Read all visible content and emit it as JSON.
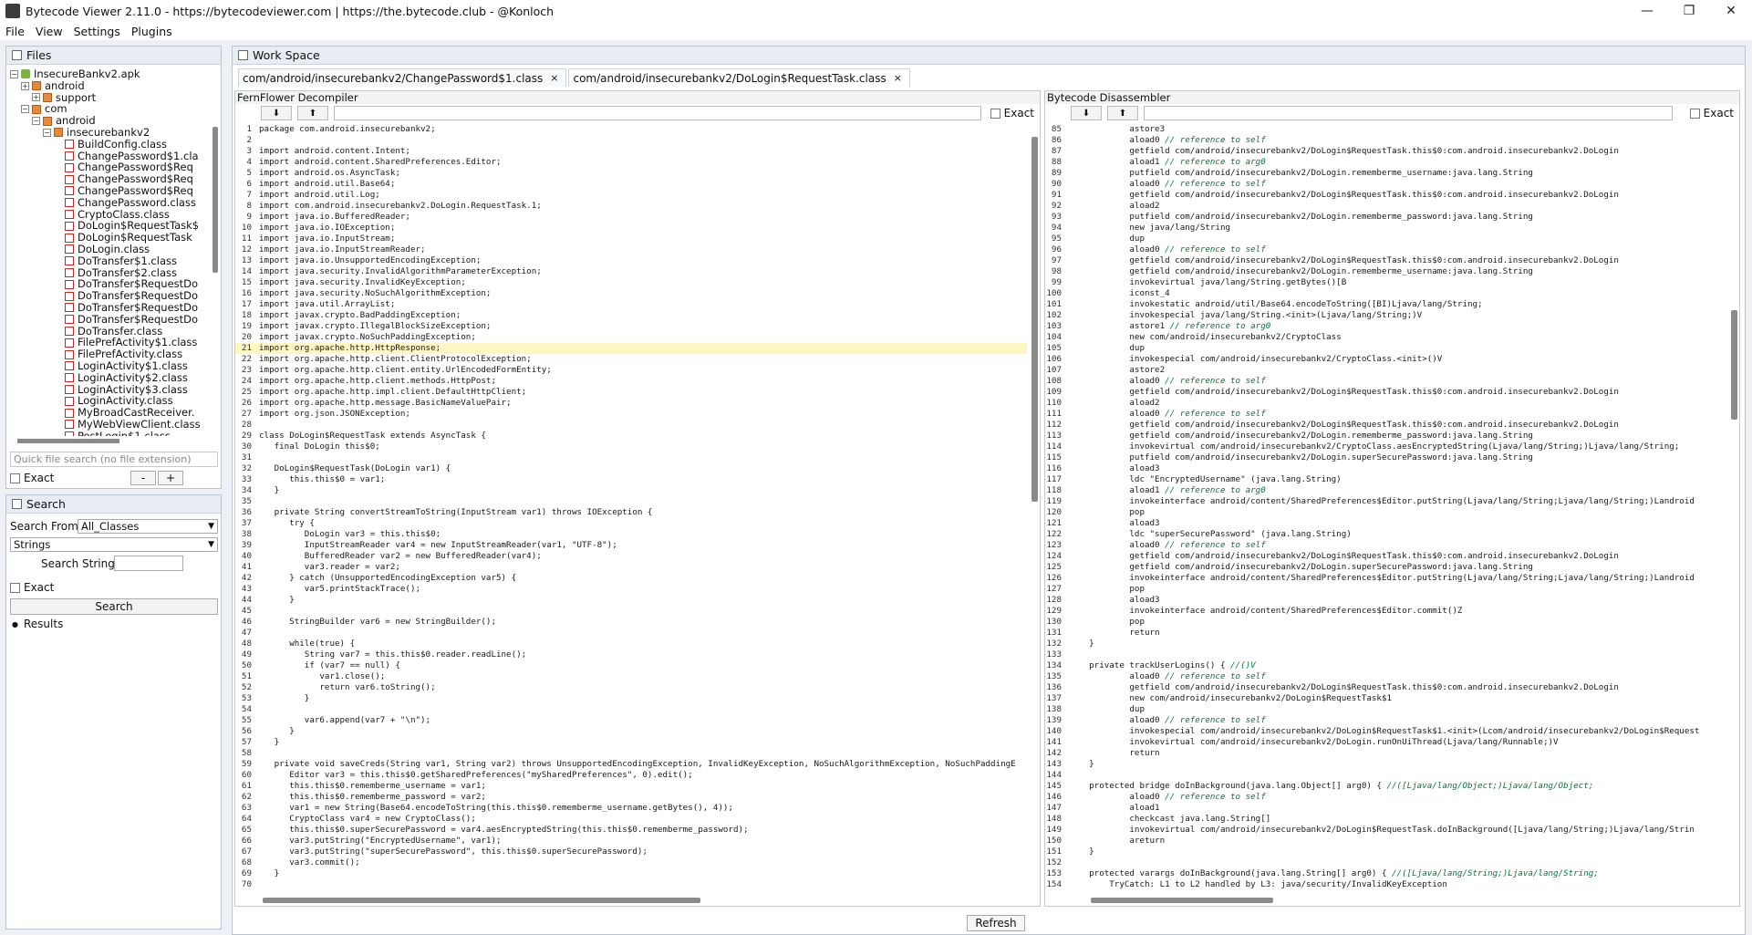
{
  "window": {
    "title": "Bytecode Viewer 2.11.0 - https://bytecodeviewer.com | https://the.bytecode.club - @Konloch"
  },
  "menu": [
    "File",
    "View",
    "Settings",
    "Plugins"
  ],
  "files": {
    "header": "Files",
    "tree": [
      {
        "label": "InsecureBankv2.apk",
        "depth": 0,
        "icon": "apk-icon",
        "exp": "−"
      },
      {
        "label": "android",
        "depth": 1,
        "icon": "package-icon",
        "exp": "+"
      },
      {
        "label": "support",
        "depth": 2,
        "icon": "package-icon",
        "exp": "+"
      },
      {
        "label": "com",
        "depth": 1,
        "icon": "package-icon",
        "exp": "−"
      },
      {
        "label": "android",
        "depth": 2,
        "icon": "package-icon",
        "exp": "−"
      },
      {
        "label": "insecurebankv2",
        "depth": 3,
        "icon": "package-icon",
        "exp": "−"
      },
      {
        "label": "BuildConfig.class",
        "depth": 4,
        "icon": "class-icon"
      },
      {
        "label": "ChangePassword$1.cla",
        "depth": 4,
        "icon": "class-icon"
      },
      {
        "label": "ChangePassword$Req",
        "depth": 4,
        "icon": "class-icon"
      },
      {
        "label": "ChangePassword$Req",
        "depth": 4,
        "icon": "class-icon"
      },
      {
        "label": "ChangePassword$Req",
        "depth": 4,
        "icon": "class-icon"
      },
      {
        "label": "ChangePassword.class",
        "depth": 4,
        "icon": "class-icon"
      },
      {
        "label": "CryptoClass.class",
        "depth": 4,
        "icon": "class-icon"
      },
      {
        "label": "DoLogin$RequestTask$",
        "depth": 4,
        "icon": "class-icon"
      },
      {
        "label": "DoLogin$RequestTask",
        "depth": 4,
        "icon": "class-icon"
      },
      {
        "label": "DoLogin.class",
        "depth": 4,
        "icon": "class-icon"
      },
      {
        "label": "DoTransfer$1.class",
        "depth": 4,
        "icon": "class-icon"
      },
      {
        "label": "DoTransfer$2.class",
        "depth": 4,
        "icon": "class-icon"
      },
      {
        "label": "DoTransfer$RequestDo",
        "depth": 4,
        "icon": "class-icon"
      },
      {
        "label": "DoTransfer$RequestDo",
        "depth": 4,
        "icon": "class-icon"
      },
      {
        "label": "DoTransfer$RequestDo",
        "depth": 4,
        "icon": "class-icon"
      },
      {
        "label": "DoTransfer$RequestDo",
        "depth": 4,
        "icon": "class-icon"
      },
      {
        "label": "DoTransfer.class",
        "depth": 4,
        "icon": "class-icon"
      },
      {
        "label": "FilePrefActivity$1.class",
        "depth": 4,
        "icon": "class-icon"
      },
      {
        "label": "FilePrefActivity.class",
        "depth": 4,
        "icon": "class-icon"
      },
      {
        "label": "LoginActivity$1.class",
        "depth": 4,
        "icon": "class-icon"
      },
      {
        "label": "LoginActivity$2.class",
        "depth": 4,
        "icon": "class-icon"
      },
      {
        "label": "LoginActivity$3.class",
        "depth": 4,
        "icon": "class-icon"
      },
      {
        "label": "LoginActivity.class",
        "depth": 4,
        "icon": "class-icon"
      },
      {
        "label": "MyBroadCastReceiver.",
        "depth": 4,
        "icon": "class-icon"
      },
      {
        "label": "MyWebViewClient.class",
        "depth": 4,
        "icon": "class-icon"
      },
      {
        "label": "PostLogin$1.class",
        "depth": 4,
        "icon": "class-icon"
      }
    ],
    "quick_search_placeholder": "Quick file search (no file extension)",
    "exact_label": "Exact",
    "minus_label": "-",
    "plus_label": "+"
  },
  "search": {
    "header": "Search",
    "from_label": "Search From:",
    "from_value": "All_Classes",
    "type_value": "Strings",
    "string_label": "Search String:",
    "exact_label": "Exact",
    "button": "Search",
    "results_label": "Results"
  },
  "workspace": {
    "header": "Work Space",
    "tabs": [
      {
        "label": "com/android/insecurebankv2/ChangePassword$1.class",
        "close": "×"
      },
      {
        "label": "com/android/insecurebankv2/DoLogin$RequestTask.class",
        "close": "×"
      }
    ],
    "refresh": "Refresh"
  },
  "decompiler": {
    "title": "FernFlower Decompiler",
    "exact_label": "Exact",
    "highlight_line": 21,
    "lines": [
      {
        "n": "1",
        "t": "package com.android.insecurebankv2;"
      },
      {
        "n": "2",
        "t": ""
      },
      {
        "n": "3",
        "t": "import android.content.Intent;"
      },
      {
        "n": "4",
        "t": "import android.content.SharedPreferences.Editor;"
      },
      {
        "n": "5",
        "t": "import android.os.AsyncTask;"
      },
      {
        "n": "6",
        "t": "import android.util.Base64;"
      },
      {
        "n": "7",
        "t": "import android.util.Log;"
      },
      {
        "n": "8",
        "t": "import com.android.insecurebankv2.DoLogin.RequestTask.1;"
      },
      {
        "n": "9",
        "t": "import java.io.BufferedReader;"
      },
      {
        "n": "10",
        "t": "import java.io.IOException;"
      },
      {
        "n": "11",
        "t": "import java.io.InputStream;"
      },
      {
        "n": "12",
        "t": "import java.io.InputStreamReader;"
      },
      {
        "n": "13",
        "t": "import java.io.UnsupportedEncodingException;"
      },
      {
        "n": "14",
        "t": "import java.security.InvalidAlgorithmParameterException;"
      },
      {
        "n": "15",
        "t": "import java.security.InvalidKeyException;"
      },
      {
        "n": "16",
        "t": "import java.security.NoSuchAlgorithmException;"
      },
      {
        "n": "17",
        "t": "import java.util.ArrayList;"
      },
      {
        "n": "18",
        "t": "import javax.crypto.BadPaddingException;"
      },
      {
        "n": "19",
        "t": "import javax.crypto.IllegalBlockSizeException;"
      },
      {
        "n": "20",
        "t": "import javax.crypto.NoSuchPaddingException;"
      },
      {
        "n": "21",
        "t": "import org.apache.http.HttpResponse;"
      },
      {
        "n": "22",
        "t": "import org.apache.http.client.ClientProtocolException;"
      },
      {
        "n": "23",
        "t": "import org.apache.http.client.entity.UrlEncodedFormEntity;"
      },
      {
        "n": "24",
        "t": "import org.apache.http.client.methods.HttpPost;"
      },
      {
        "n": "25",
        "t": "import org.apache.http.impl.client.DefaultHttpClient;"
      },
      {
        "n": "26",
        "t": "import org.apache.http.message.BasicNameValuePair;"
      },
      {
        "n": "27",
        "t": "import org.json.JSONException;"
      },
      {
        "n": "28",
        "t": ""
      },
      {
        "n": "29",
        "t": "class DoLogin$RequestTask extends AsyncTask {"
      },
      {
        "n": "30",
        "t": "   final DoLogin this$0;"
      },
      {
        "n": "31",
        "t": ""
      },
      {
        "n": "32",
        "t": "   DoLogin$RequestTask(DoLogin var1) {"
      },
      {
        "n": "33",
        "t": "      this.this$0 = var1;"
      },
      {
        "n": "34",
        "t": "   }"
      },
      {
        "n": "35",
        "t": ""
      },
      {
        "n": "36",
        "t": "   private String convertStreamToString(InputStream var1) throws IOException {"
      },
      {
        "n": "37",
        "t": "      try {"
      },
      {
        "n": "38",
        "t": "         DoLogin var3 = this.this$0;"
      },
      {
        "n": "39",
        "t": "         InputStreamReader var4 = new InputStreamReader(var1, \"UTF-8\");"
      },
      {
        "n": "40",
        "t": "         BufferedReader var2 = new BufferedReader(var4);"
      },
      {
        "n": "41",
        "t": "         var3.reader = var2;"
      },
      {
        "n": "42",
        "t": "      } catch (UnsupportedEncodingException var5) {"
      },
      {
        "n": "43",
        "t": "         var5.printStackTrace();"
      },
      {
        "n": "44",
        "t": "      }"
      },
      {
        "n": "45",
        "t": ""
      },
      {
        "n": "46",
        "t": "      StringBuilder var6 = new StringBuilder();"
      },
      {
        "n": "47",
        "t": ""
      },
      {
        "n": "48",
        "t": "      while(true) {"
      },
      {
        "n": "49",
        "t": "         String var7 = this.this$0.reader.readLine();"
      },
      {
        "n": "50",
        "t": "         if (var7 == null) {"
      },
      {
        "n": "51",
        "t": "            var1.close();"
      },
      {
        "n": "52",
        "t": "            return var6.toString();"
      },
      {
        "n": "53",
        "t": "         }"
      },
      {
        "n": "54",
        "t": ""
      },
      {
        "n": "55",
        "t": "         var6.append(var7 + \"\\n\");"
      },
      {
        "n": "56",
        "t": "      }"
      },
      {
        "n": "57",
        "t": "   }"
      },
      {
        "n": "58",
        "t": ""
      },
      {
        "n": "59",
        "t": "   private void saveCreds(String var1, String var2) throws UnsupportedEncodingException, InvalidKeyException, NoSuchAlgorithmException, NoSuchPaddingE"
      },
      {
        "n": "60",
        "t": "      Editor var3 = this.this$0.getSharedPreferences(\"mySharedPreferences\", 0).edit();"
      },
      {
        "n": "61",
        "t": "      this.this$0.rememberme_username = var1;"
      },
      {
        "n": "62",
        "t": "      this.this$0.rememberme_password = var2;"
      },
      {
        "n": "63",
        "t": "      var1 = new String(Base64.encodeToString(this.this$0.rememberme_username.getBytes(), 4));"
      },
      {
        "n": "64",
        "t": "      CryptoClass var4 = new CryptoClass();"
      },
      {
        "n": "65",
        "t": "      this.this$0.superSecurePassword = var4.aesEncryptedString(this.this$0.rememberme_password);"
      },
      {
        "n": "66",
        "t": "      var3.putString(\"EncryptedUsername\", var1);"
      },
      {
        "n": "67",
        "t": "      var3.putString(\"superSecurePassword\", this.this$0.superSecurePassword);"
      },
      {
        "n": "68",
        "t": "      var3.commit();"
      },
      {
        "n": "69",
        "t": "   }"
      },
      {
        "n": "70",
        "t": ""
      }
    ]
  },
  "disassembler": {
    "title": "Bytecode Disassembler",
    "exact_label": "Exact",
    "lines": [
      {
        "n": "85",
        "t": "            astore3"
      },
      {
        "n": "86",
        "t": "            aload0 // reference to self"
      },
      {
        "n": "87",
        "t": "            getfield com/android/insecurebankv2/DoLogin$RequestTask.this$0:com.android.insecurebankv2.DoLogin"
      },
      {
        "n": "88",
        "t": "            aload1 // reference to arg0"
      },
      {
        "n": "89",
        "t": "            putfield com/android/insecurebankv2/DoLogin.rememberme_username:java.lang.String"
      },
      {
        "n": "90",
        "t": "            aload0 // reference to self"
      },
      {
        "n": "91",
        "t": "            getfield com/android/insecurebankv2/DoLogin$RequestTask.this$0:com.android.insecurebankv2.DoLogin"
      },
      {
        "n": "92",
        "t": "            aload2"
      },
      {
        "n": "93",
        "t": "            putfield com/android/insecurebankv2/DoLogin.rememberme_password:java.lang.String"
      },
      {
        "n": "94",
        "t": "            new java/lang/String"
      },
      {
        "n": "95",
        "t": "            dup"
      },
      {
        "n": "96",
        "t": "            aload0 // reference to self"
      },
      {
        "n": "97",
        "t": "            getfield com/android/insecurebankv2/DoLogin$RequestTask.this$0:com.android.insecurebankv2.DoLogin"
      },
      {
        "n": "98",
        "t": "            getfield com/android/insecurebankv2/DoLogin.rememberme_username:java.lang.String"
      },
      {
        "n": "99",
        "t": "            invokevirtual java/lang/String.getBytes()[B"
      },
      {
        "n": "100",
        "t": "            iconst_4"
      },
      {
        "n": "101",
        "t": "            invokestatic android/util/Base64.encodeToString([BI)Ljava/lang/String;"
      },
      {
        "n": "102",
        "t": "            invokespecial java/lang/String.<init>(Ljava/lang/String;)V"
      },
      {
        "n": "103",
        "t": "            astore1 // reference to arg0"
      },
      {
        "n": "104",
        "t": "            new com/android/insecurebankv2/CryptoClass"
      },
      {
        "n": "105",
        "t": "            dup"
      },
      {
        "n": "106",
        "t": "            invokespecial com/android/insecurebankv2/CryptoClass.<init>()V"
      },
      {
        "n": "107",
        "t": "            astore2"
      },
      {
        "n": "108",
        "t": "            aload0 // reference to self"
      },
      {
        "n": "109",
        "t": "            getfield com/android/insecurebankv2/DoLogin$RequestTask.this$0:com.android.insecurebankv2.DoLogin"
      },
      {
        "n": "110",
        "t": "            aload2"
      },
      {
        "n": "111",
        "t": "            aload0 // reference to self"
      },
      {
        "n": "112",
        "t": "            getfield com/android/insecurebankv2/DoLogin$RequestTask.this$0:com.android.insecurebankv2.DoLogin"
      },
      {
        "n": "113",
        "t": "            getfield com/android/insecurebankv2/DoLogin.rememberme_password:java.lang.String"
      },
      {
        "n": "114",
        "t": "            invokevirtual com/android/insecurebankv2/CryptoClass.aesEncryptedString(Ljava/lang/String;)Ljava/lang/String;"
      },
      {
        "n": "115",
        "t": "            putfield com/android/insecurebankv2/DoLogin.superSecurePassword:java.lang.String"
      },
      {
        "n": "116",
        "t": "            aload3"
      },
      {
        "n": "117",
        "t": "            ldc \"EncryptedUsername\" (java.lang.String)"
      },
      {
        "n": "118",
        "t": "            aload1 // reference to arg0"
      },
      {
        "n": "119",
        "t": "            invokeinterface android/content/SharedPreferences$Editor.putString(Ljava/lang/String;Ljava/lang/String;)Landroid"
      },
      {
        "n": "120",
        "t": "            pop"
      },
      {
        "n": "121",
        "t": "            aload3"
      },
      {
        "n": "122",
        "t": "            ldc \"superSecurePassword\" (java.lang.String)"
      },
      {
        "n": "123",
        "t": "            aload0 // reference to self"
      },
      {
        "n": "124",
        "t": "            getfield com/android/insecurebankv2/DoLogin$RequestTask.this$0:com.android.insecurebankv2.DoLogin"
      },
      {
        "n": "125",
        "t": "            getfield com/android/insecurebankv2/DoLogin.superSecurePassword:java.lang.String"
      },
      {
        "n": "126",
        "t": "            invokeinterface android/content/SharedPreferences$Editor.putString(Ljava/lang/String;Ljava/lang/String;)Landroid"
      },
      {
        "n": "127",
        "t": "            pop"
      },
      {
        "n": "128",
        "t": "            aload3"
      },
      {
        "n": "129",
        "t": "            invokeinterface android/content/SharedPreferences$Editor.commit()Z"
      },
      {
        "n": "130",
        "t": "            pop"
      },
      {
        "n": "131",
        "t": "            return"
      },
      {
        "n": "132",
        "t": "    }"
      },
      {
        "n": "133",
        "t": ""
      },
      {
        "n": "134",
        "t": "    private trackUserLogins() { //()V"
      },
      {
        "n": "135",
        "t": "            aload0 // reference to self"
      },
      {
        "n": "136",
        "t": "            getfield com/android/insecurebankv2/DoLogin$RequestTask.this$0:com.android.insecurebankv2.DoLogin"
      },
      {
        "n": "137",
        "t": "            new com/android/insecurebankv2/DoLogin$RequestTask$1"
      },
      {
        "n": "138",
        "t": "            dup"
      },
      {
        "n": "139",
        "t": "            aload0 // reference to self"
      },
      {
        "n": "140",
        "t": "            invokespecial com/android/insecurebankv2/DoLogin$RequestTask$1.<init>(Lcom/android/insecurebankv2/DoLogin$Request"
      },
      {
        "n": "141",
        "t": "            invokevirtual com/android/insecurebankv2/DoLogin.runOnUiThread(Ljava/lang/Runnable;)V"
      },
      {
        "n": "142",
        "t": "            return"
      },
      {
        "n": "143",
        "t": "    }"
      },
      {
        "n": "144",
        "t": ""
      },
      {
        "n": "145",
        "t": "    protected bridge doInBackground(java.lang.Object[] arg0) { //([Ljava/lang/Object;)Ljava/lang/Object;"
      },
      {
        "n": "146",
        "t": "            aload0 // reference to self"
      },
      {
        "n": "147",
        "t": "            aload1"
      },
      {
        "n": "148",
        "t": "            checkcast java.lang.String[]"
      },
      {
        "n": "149",
        "t": "            invokevirtual com/android/insecurebankv2/DoLogin$RequestTask.doInBackground([Ljava/lang/String;)Ljava/lang/Strin"
      },
      {
        "n": "150",
        "t": "            areturn"
      },
      {
        "n": "151",
        "t": "    }"
      },
      {
        "n": "152",
        "t": ""
      },
      {
        "n": "153",
        "t": "    protected varargs doInBackground(java.lang.String[] arg0) { //([Ljava/lang/String;)Ljava/lang/String;"
      },
      {
        "n": "154",
        "t": "        TryCatch: L1 to L2 handled by L3: java/security/InvalidKeyException"
      }
    ]
  }
}
